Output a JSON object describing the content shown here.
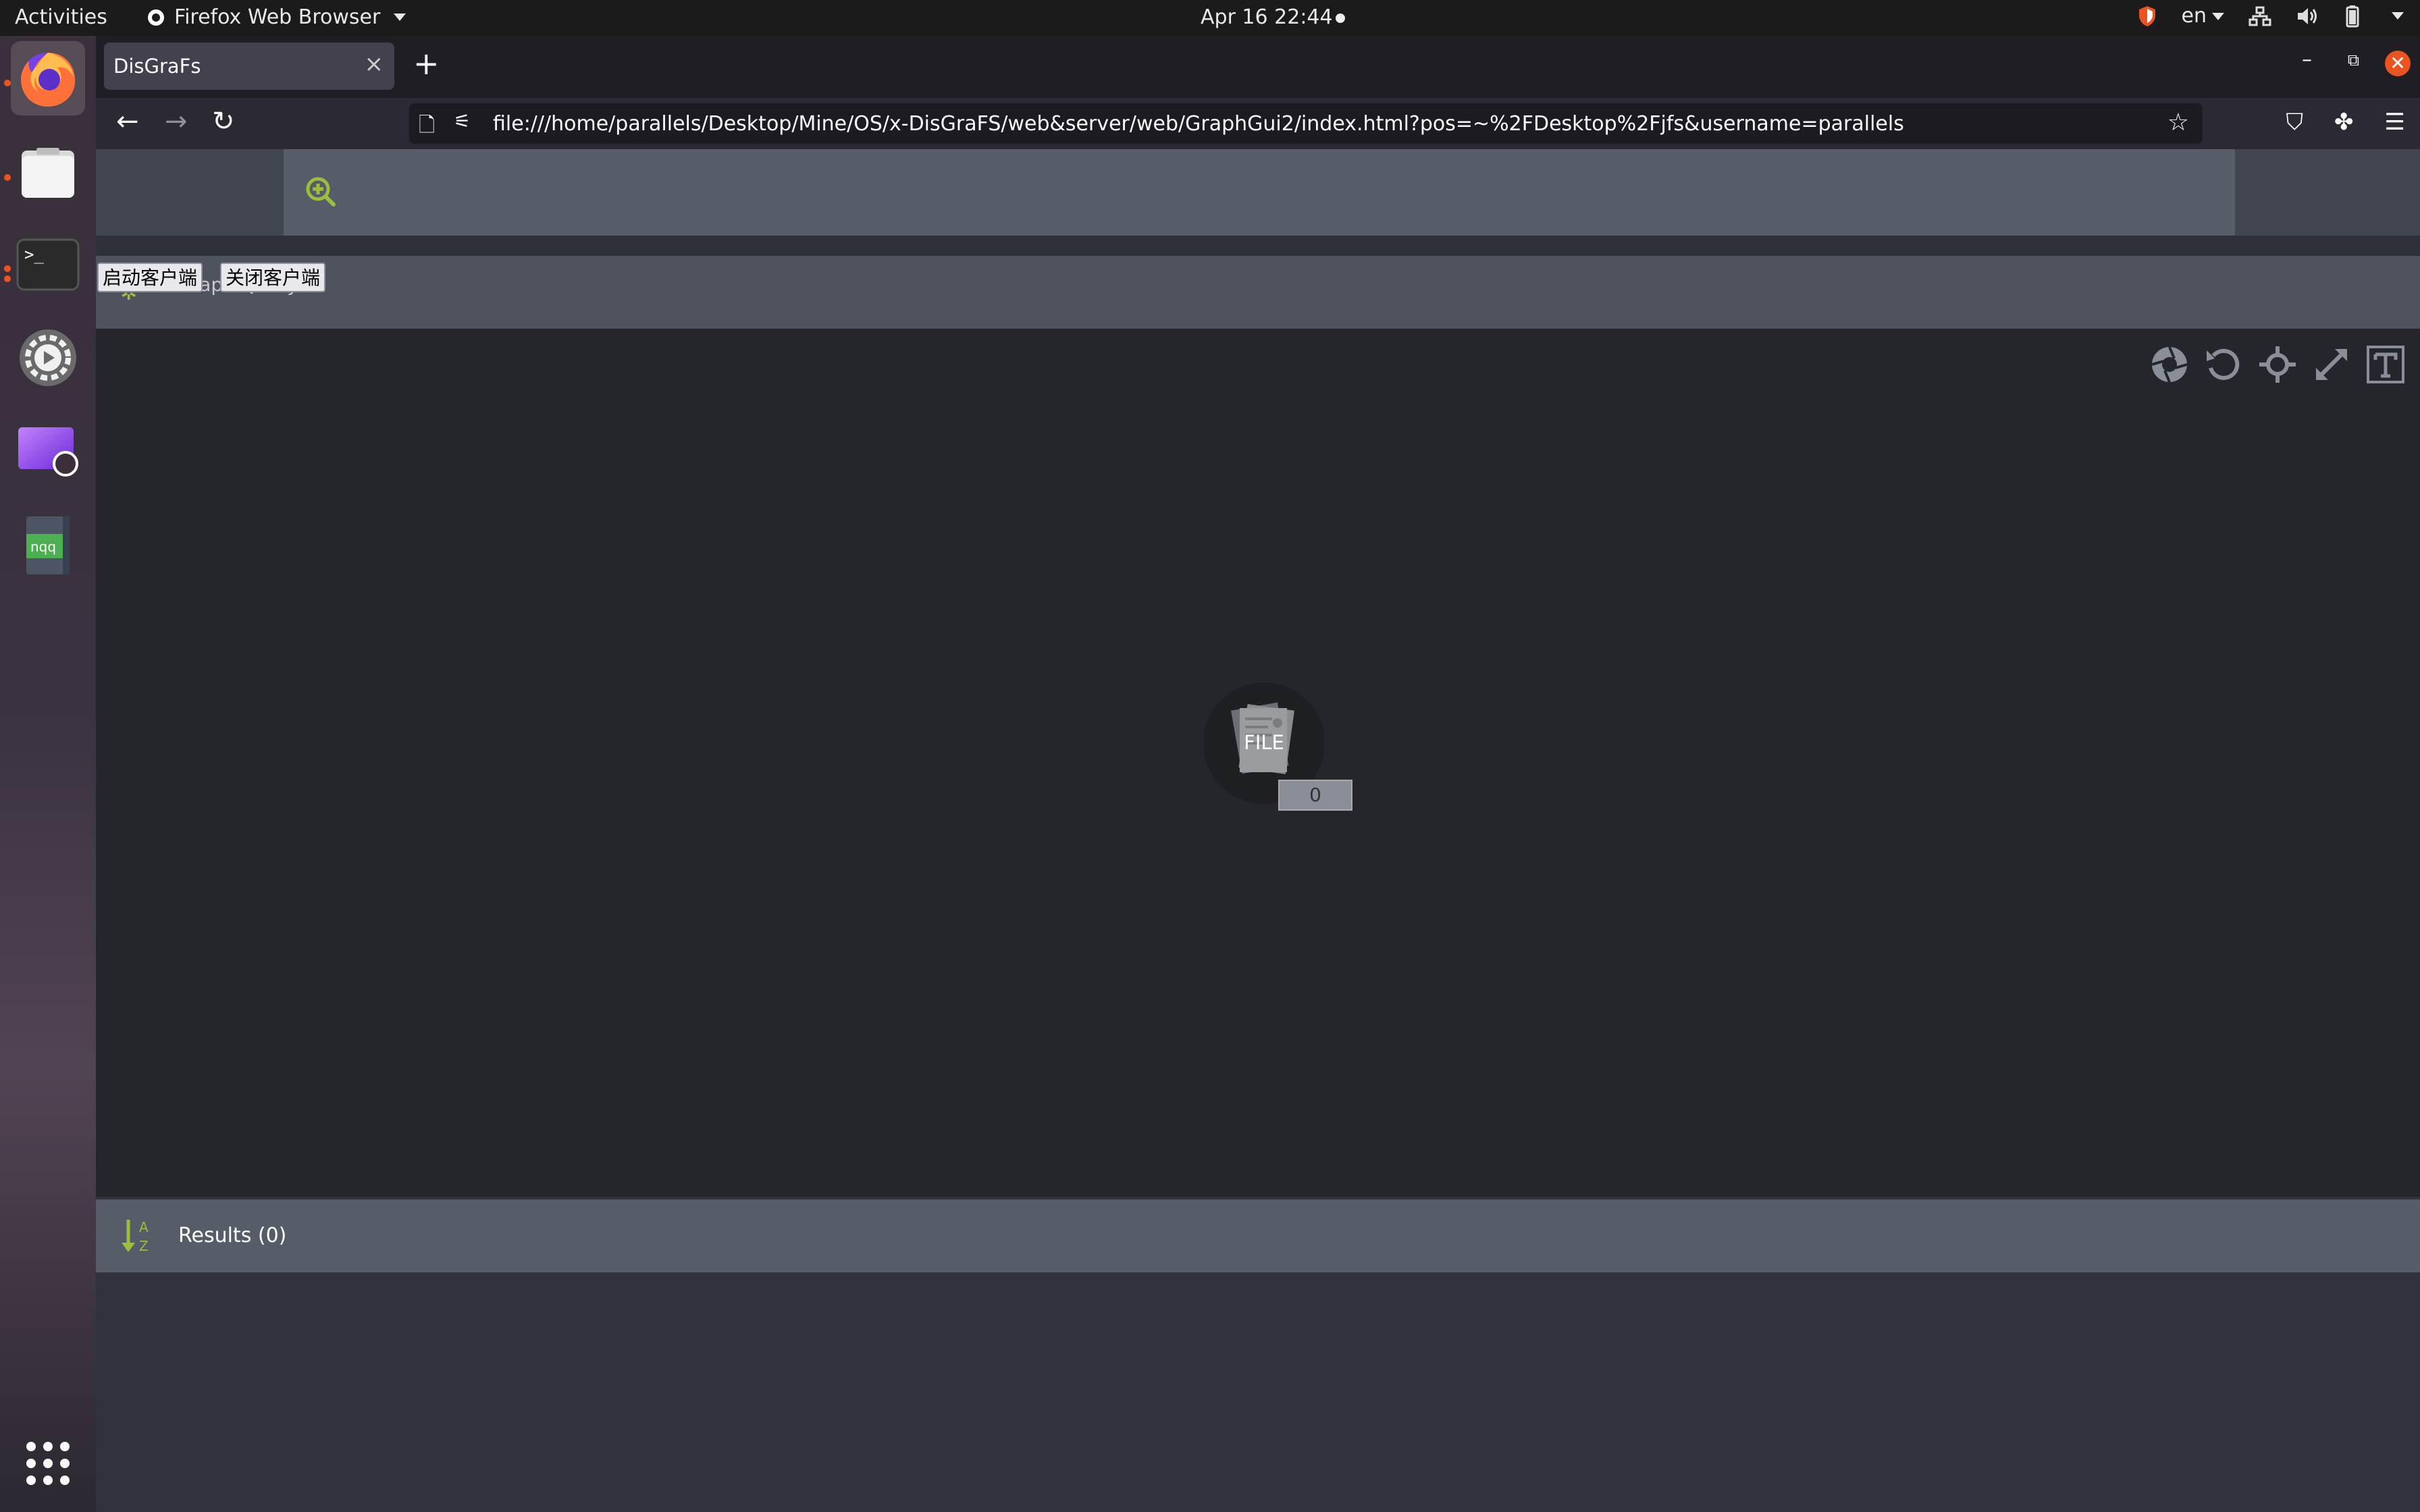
{
  "topbar": {
    "activities": "Activities",
    "app_name": "Firefox Web Browser",
    "clock": "Apr 16  22:44",
    "language": "en"
  },
  "dock": {
    "items": [
      "firefox-icon",
      "files-icon",
      "terminal-icon",
      "settings-icon",
      "screen-recorder-icon",
      "notepadqq-icon"
    ],
    "notepad_label": "nqq"
  },
  "browser": {
    "tab_title": "DisGraFs",
    "url": "file:///home/parallels/Desktop/Mine/OS/x-DisGraFS/web&server/web/GraphGui2/index.html?pos=~%2FDesktop%2Fjfs&username=parallels"
  },
  "page": {
    "start_client": "启动客户端",
    "close_client": "关闭客户端",
    "query_title": "Graph Query",
    "node_label": "FILE",
    "node_count": "0",
    "results_label": "Results (0)"
  },
  "colors": {
    "accent": "#9bbf3a",
    "ubuntu_orange": "#e95420"
  }
}
